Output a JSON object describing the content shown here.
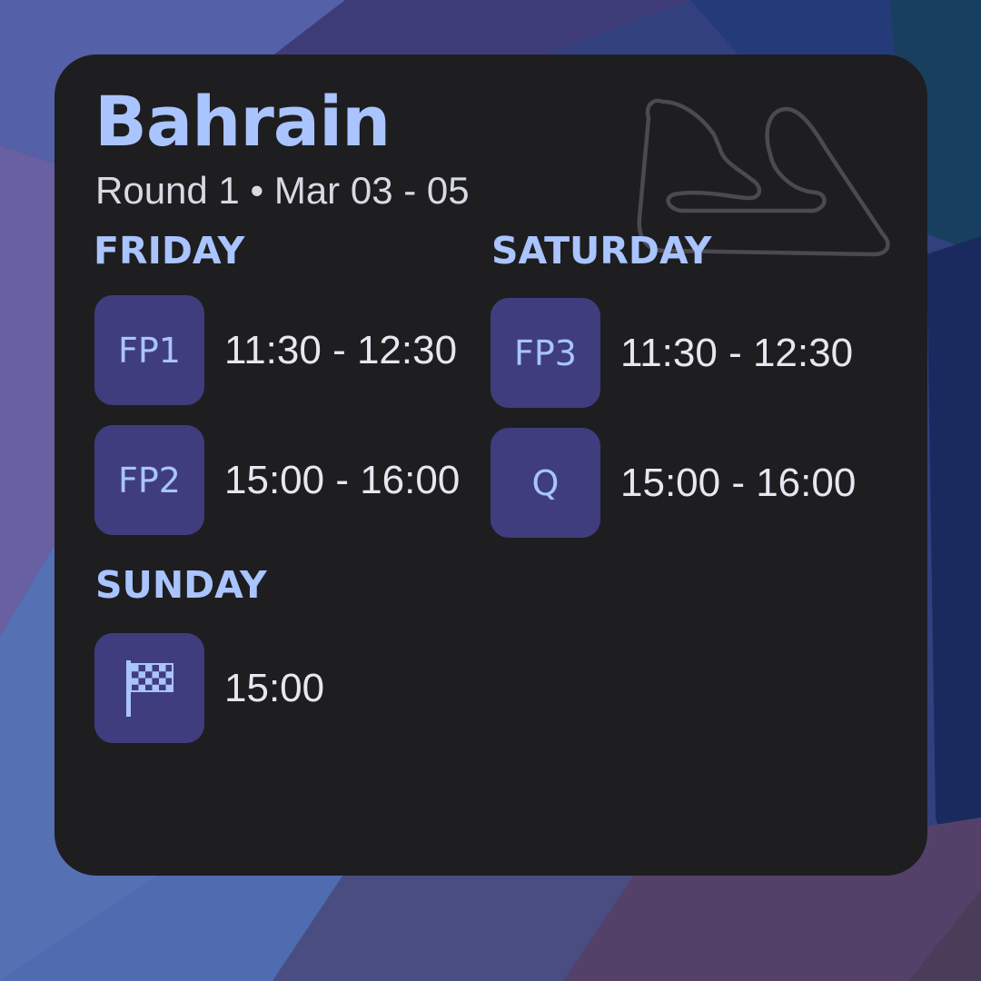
{
  "event": {
    "title": "Bahrain",
    "subtitle": "Round 1 • Mar 03 - 05"
  },
  "days": {
    "friday": {
      "label": "FRIDAY",
      "sessions": [
        {
          "code": "FP1",
          "time": "11:30 - 12:30"
        },
        {
          "code": "FP2",
          "time": "15:00 - 16:00"
        }
      ]
    },
    "saturday": {
      "label": "SATURDAY",
      "sessions": [
        {
          "code": "FP3",
          "time": "11:30 - 12:30"
        },
        {
          "code": "Q",
          "time": "15:00 - 16:00"
        }
      ]
    },
    "sunday": {
      "label": "SUNDAY",
      "sessions": [
        {
          "icon": "checkered-flag-icon",
          "time": "15:00"
        }
      ]
    }
  },
  "colors": {
    "accent": "#a9c4ff",
    "card": "#1e1e20",
    "tile": "#3f3d7e",
    "text": "#e6e7f0",
    "track_outline": "#4a4a50"
  }
}
